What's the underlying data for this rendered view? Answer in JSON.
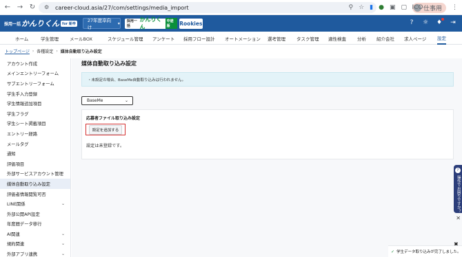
{
  "browser": {
    "url": "career-cloud.asia/27/com/settings/media_import",
    "profile_label": "仕事用",
    "profile_initials": "ICO"
  },
  "appbar": {
    "brand1": {
      "prefix": "採用一括",
      "name": "かんりくん",
      "tag": "for 新卒"
    },
    "year_select": "27年度卒向け",
    "brand2": {
      "prefix": "採用一括",
      "name": "かんりくん",
      "tag": "中途版"
    },
    "brand3": "Rookies"
  },
  "menu": {
    "items": [
      {
        "label": "ホーム"
      },
      {
        "label": "学生管理"
      },
      {
        "label": "メールBOX"
      },
      {
        "label": "スケジュール管理"
      },
      {
        "label": "アンケート"
      },
      {
        "label": "採用フロー設計"
      },
      {
        "label": "オートメーション"
      },
      {
        "label": "選考管理"
      },
      {
        "label": "タスク管理"
      },
      {
        "label": "適性検査"
      },
      {
        "label": "分析"
      },
      {
        "label": "紹介会社"
      },
      {
        "label": "求人ページ"
      },
      {
        "label": "設定"
      }
    ]
  },
  "breadcrumb": {
    "top": "トップページ",
    "settings": "各種設定",
    "current": "媒体自動取り込み設定"
  },
  "sidebar": {
    "items": [
      {
        "label": "アカウント作成"
      },
      {
        "label": "メインエントリーフォーム"
      },
      {
        "label": "サブエントリーフォーム"
      },
      {
        "label": "学生手入力登録"
      },
      {
        "label": "学生情報追加項目"
      },
      {
        "label": "学生フラグ"
      },
      {
        "label": "学生シート掲載項目"
      },
      {
        "label": "エントリー経路"
      },
      {
        "label": "メールタグ"
      },
      {
        "label": "通知"
      },
      {
        "label": "評価項目"
      },
      {
        "label": "外部サービスアカウント管理"
      },
      {
        "label": "媒体自動取り込み設定"
      },
      {
        "label": "評価者情報閲覧可否"
      },
      {
        "label": "LINE関係"
      },
      {
        "label": "外部公開API設定"
      },
      {
        "label": "年度間データ移行"
      },
      {
        "label": "AI関連"
      },
      {
        "label": "規約関連"
      },
      {
        "label": "外部アプリ連携"
      }
    ]
  },
  "main": {
    "title": "媒体自動取り込み設定",
    "notice": "・未設定の場合、BaseMe自動取り込みは行われません。",
    "media_select": "BaseMe",
    "card_title": "応募者ファイル取り込み設定",
    "add_button": "設定を追加する",
    "empty_text": "設定は未登録です。"
  },
  "help_tab": {
    "label": "操作でお困りですか？"
  },
  "toast": {
    "message": "学生データ取り込みが完了しました。"
  }
}
